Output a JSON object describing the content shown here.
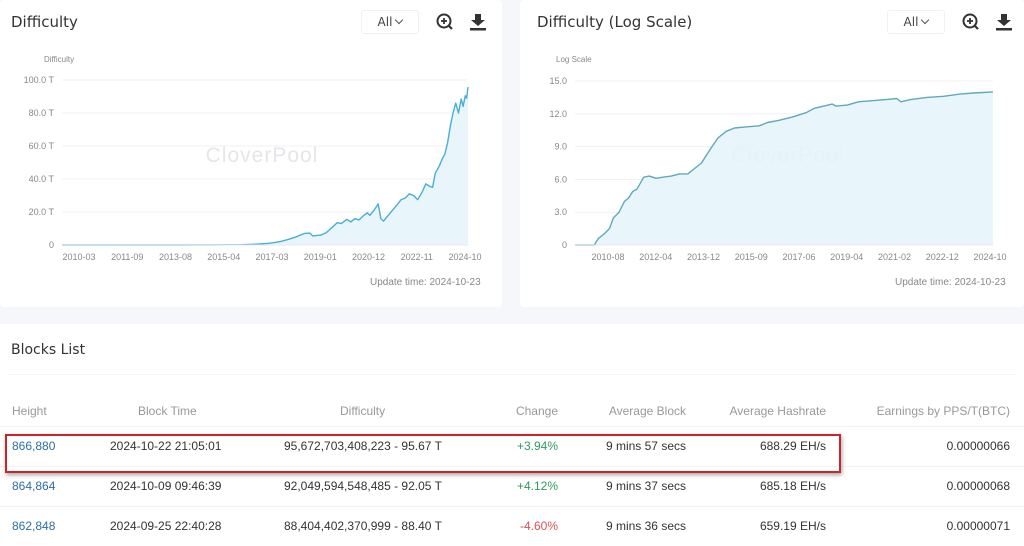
{
  "charts": {
    "left": {
      "title": "Difficulty",
      "range_selected": "All",
      "zoom_icon": "zoom-in-icon",
      "download_icon": "download-icon",
      "update_time": "Update time: 2024-10-23",
      "watermark": "CloverPool"
    },
    "right": {
      "title": "Difficulty (Log Scale)",
      "range_selected": "All",
      "zoom_icon": "zoom-in-icon",
      "download_icon": "download-icon",
      "update_time": "Update time: 2024-10-23",
      "watermark": "CloverPool"
    }
  },
  "chart_data": [
    {
      "type": "area",
      "title": "Difficulty",
      "ylabel": "Difficulty",
      "xlabel": "",
      "ylim": [
        0,
        100
      ],
      "y_unit": "T",
      "yticks": [
        "0",
        "20.0 T",
        "40.0 T",
        "60.0 T",
        "80.0 T",
        "100.0 T"
      ],
      "xticks": [
        "2010-03",
        "2011-09",
        "2013-08",
        "2015-04",
        "2017-03",
        "2019-01",
        "2020-12",
        "2022-11",
        "2024-10"
      ],
      "x_range": [
        2009.9,
        2024.8
      ],
      "grid": true,
      "color": "#4aaed4",
      "fill": "#e4f4fb",
      "points": [
        [
          2009.9,
          0
        ],
        [
          2012.0,
          0
        ],
        [
          2014.0,
          0.03
        ],
        [
          2015.5,
          0.06
        ],
        [
          2016.5,
          0.2
        ],
        [
          2017.0,
          0.5
        ],
        [
          2017.5,
          1.0
        ],
        [
          2017.9,
          2.0
        ],
        [
          2018.2,
          3.4
        ],
        [
          2018.5,
          5.0
        ],
        [
          2018.8,
          7.0
        ],
        [
          2019.0,
          7.2
        ],
        [
          2019.1,
          5.5
        ],
        [
          2019.4,
          6.0
        ],
        [
          2019.6,
          7.5
        ],
        [
          2019.8,
          10.5
        ],
        [
          2020.0,
          13.5
        ],
        [
          2020.15,
          13.0
        ],
        [
          2020.35,
          15.5
        ],
        [
          2020.5,
          14.0
        ],
        [
          2020.65,
          16.0
        ],
        [
          2020.8,
          15.2
        ],
        [
          2020.95,
          17.5
        ],
        [
          2021.1,
          19.5
        ],
        [
          2021.2,
          18.0
        ],
        [
          2021.35,
          21.0
        ],
        [
          2021.45,
          23.5
        ],
        [
          2021.5,
          25.0
        ],
        [
          2021.55,
          21.0
        ],
        [
          2021.6,
          16.0
        ],
        [
          2021.7,
          14.5
        ],
        [
          2021.85,
          17.5
        ],
        [
          2022.0,
          20.5
        ],
        [
          2022.2,
          24.5
        ],
        [
          2022.35,
          27.5
        ],
        [
          2022.5,
          28.5
        ],
        [
          2022.65,
          31.0
        ],
        [
          2022.8,
          30.0
        ],
        [
          2022.95,
          27.5
        ],
        [
          2023.1,
          31.5
        ],
        [
          2023.25,
          37.0
        ],
        [
          2023.4,
          35.5
        ],
        [
          2023.5,
          35.0
        ],
        [
          2023.6,
          43.5
        ],
        [
          2023.75,
          48.0
        ],
        [
          2023.85,
          52.0
        ],
        [
          2023.95,
          55.0
        ],
        [
          2024.05,
          62.0
        ],
        [
          2024.15,
          72.0
        ],
        [
          2024.25,
          80.0
        ],
        [
          2024.35,
          86.0
        ],
        [
          2024.45,
          80.0
        ],
        [
          2024.55,
          88.5
        ],
        [
          2024.62,
          84.0
        ],
        [
          2024.7,
          90.5
        ],
        [
          2024.75,
          89.0
        ],
        [
          2024.8,
          95.7
        ]
      ]
    },
    {
      "type": "area",
      "title": "Difficulty (Log Scale)",
      "ylabel": "Log Scale",
      "xlabel": "",
      "ylim": [
        0,
        15
      ],
      "yticks": [
        "0",
        "3.0",
        "6.0",
        "9.0",
        "12.0",
        "15.0"
      ],
      "xticks": [
        "2010-08",
        "2012-04",
        "2013-12",
        "2015-09",
        "2017-06",
        "2019-04",
        "2021-02",
        "2022-12",
        "2024-10"
      ],
      "x_range": [
        2009.6,
        2024.8
      ],
      "grid": true,
      "color": "#5fa9b8",
      "fill": "#e4f4fb",
      "points": [
        [
          2009.6,
          0
        ],
        [
          2010.3,
          0
        ],
        [
          2010.45,
          0.6
        ],
        [
          2010.65,
          1.0
        ],
        [
          2010.85,
          1.5
        ],
        [
          2011.0,
          2.5
        ],
        [
          2011.2,
          3.0
        ],
        [
          2011.4,
          4.0
        ],
        [
          2011.55,
          4.3
        ],
        [
          2011.7,
          4.9
        ],
        [
          2011.85,
          5.1
        ],
        [
          2012.1,
          6.2
        ],
        [
          2012.3,
          6.3
        ],
        [
          2012.55,
          6.1
        ],
        [
          2012.8,
          6.2
        ],
        [
          2013.1,
          6.3
        ],
        [
          2013.4,
          6.5
        ],
        [
          2013.7,
          6.5
        ],
        [
          2013.95,
          7.0
        ],
        [
          2014.2,
          7.5
        ],
        [
          2014.5,
          8.7
        ],
        [
          2014.8,
          9.8
        ],
        [
          2015.1,
          10.4
        ],
        [
          2015.4,
          10.7
        ],
        [
          2015.8,
          10.8
        ],
        [
          2016.3,
          10.9
        ],
        [
          2016.6,
          11.2
        ],
        [
          2017.0,
          11.4
        ],
        [
          2017.5,
          11.7
        ],
        [
          2018.0,
          12.1
        ],
        [
          2018.3,
          12.5
        ],
        [
          2018.8,
          12.8
        ],
        [
          2018.95,
          12.9
        ],
        [
          2019.1,
          12.7
        ],
        [
          2019.5,
          12.8
        ],
        [
          2019.9,
          13.1
        ],
        [
          2020.4,
          13.2
        ],
        [
          2020.9,
          13.3
        ],
        [
          2021.3,
          13.4
        ],
        [
          2021.45,
          13.1
        ],
        [
          2021.8,
          13.3
        ],
        [
          2022.4,
          13.5
        ],
        [
          2023.0,
          13.6
        ],
        [
          2023.6,
          13.8
        ],
        [
          2024.1,
          13.9
        ],
        [
          2024.8,
          14.0
        ]
      ]
    }
  ],
  "blocks_list": {
    "title": "Blocks List",
    "columns": [
      "Height",
      "Block Time",
      "Difficulty",
      "Change",
      "Average Block",
      "Average Hashrate",
      "Earnings by PPS/T(BTC)"
    ],
    "rows": [
      {
        "height": "866,880",
        "time": "2024-10-22 21:05:01",
        "difficulty": "95,672,703,408,223 - 95.67 T",
        "change": "+3.94%",
        "change_dir": "up",
        "avg_block": "9 mins 57 secs",
        "hashrate": "688.29 EH/s",
        "earnings": "0.00000066",
        "highlighted": true
      },
      {
        "height": "864,864",
        "time": "2024-10-09 09:46:39",
        "difficulty": "92,049,594,548,485 - 92.05 T",
        "change": "+4.12%",
        "change_dir": "up",
        "avg_block": "9 mins 37 secs",
        "hashrate": "685.18 EH/s",
        "earnings": "0.00000068",
        "highlighted": false
      },
      {
        "height": "862,848",
        "time": "2024-09-25 22:40:28",
        "difficulty": "88,404,402,370,999 - 88.40 T",
        "change": "-4.60%",
        "change_dir": "down",
        "avg_block": "9 mins 36 secs",
        "hashrate": "659.19 EH/s",
        "earnings": "0.00000071",
        "highlighted": false
      }
    ],
    "highlight_color": "#c9252b"
  }
}
